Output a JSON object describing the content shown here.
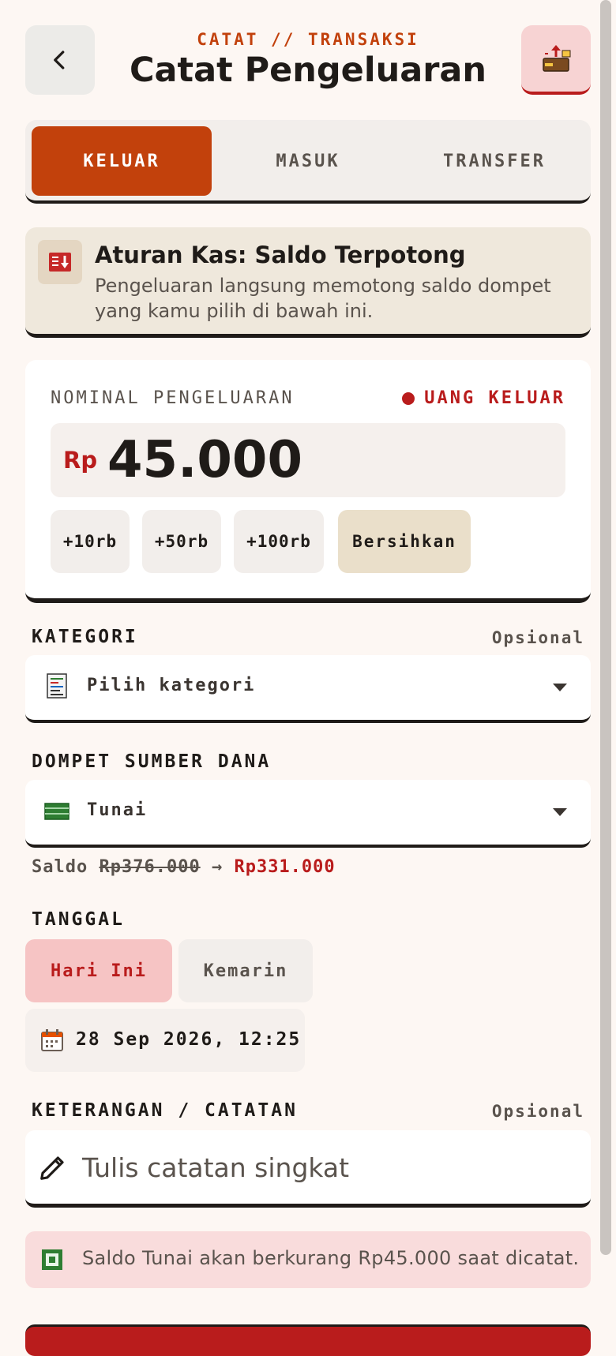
{
  "header": {
    "eyebrow": "CATAT // TRANSAKSI",
    "title": "Catat Pengeluaran",
    "back_icon": "chevron-left-icon",
    "action_icon": "wallet-out-icon"
  },
  "tabs": [
    {
      "label": "KELUAR",
      "active": true
    },
    {
      "label": "MASUK",
      "active": false
    },
    {
      "label": "TRANSFER",
      "active": false
    }
  ],
  "rule": {
    "icon": "cash-out-icon",
    "title": "Aturan Kas: Saldo Terpotong",
    "description": "Pengeluaran langsung memotong saldo dompet yang kamu pilih di bawah ini."
  },
  "amount": {
    "label": "NOMINAL PENGELUARAN",
    "status": "UANG KELUAR",
    "currency": "Rp",
    "value": "45.000",
    "quick_buttons": [
      "+10rb",
      "+50rb",
      "+100rb"
    ],
    "clear_label": "Bersihkan"
  },
  "category": {
    "label": "KATEGORI",
    "optional": "Opsional",
    "placeholder": "Pilih kategori",
    "icon": "receipt-icon"
  },
  "wallet": {
    "label": "DOMPET SUMBER DANA",
    "value": "Tunai",
    "icon": "cash-icon",
    "balance_prefix": "Saldo",
    "balance_old": "Rp376.000",
    "arrow": "→",
    "balance_new": "Rp331.000"
  },
  "date": {
    "label": "TANGGAL",
    "today": "Hari Ini",
    "yesterday": "Kemarin",
    "datetime": "28 Sep 2026, 12:25",
    "icon": "calendar-icon"
  },
  "note": {
    "label": "KETERANGAN / CATATAN",
    "optional": "Opsional",
    "placeholder": "Tulis catatan singkat",
    "icon": "pencil-icon"
  },
  "info": {
    "text": "Saldo Tunai akan berkurang Rp45.000 saat dicatat.",
    "icon": "info-square-icon"
  },
  "colors": {
    "accent": "#c2410c",
    "danger": "#b91c1c",
    "background": "#fdf7f3"
  }
}
